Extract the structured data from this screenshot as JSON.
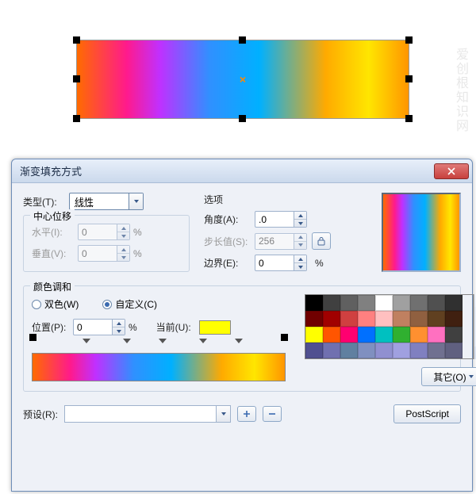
{
  "canvas": {
    "center_marker": "×"
  },
  "dialog": {
    "title": "渐变填充方式",
    "type_label": "类型(T):",
    "type_value": "线性",
    "center_shift_title": "中心位移",
    "horizontal_label": "水平(I):",
    "horizontal_value": "0",
    "vertical_label": "垂直(V):",
    "vertical_value": "0",
    "percent": "%",
    "options_title": "选项",
    "angle_label": "角度(A):",
    "angle_value": ".0",
    "step_label": "步长值(S):",
    "step_value": "256",
    "edge_label": "边界(E):",
    "edge_value": "0",
    "harmony_title": "颜色调和",
    "two_color_label": "双色(W)",
    "custom_label": "自定义(C)",
    "position_label": "位置(P):",
    "position_value": "0",
    "current_label": "当前(U):",
    "current_color": "#ffff00",
    "other_btn": "其它(O)",
    "preset_label": "预设(R):",
    "postscript_btn": "PostScript",
    "palette": [
      [
        "#000000",
        "#404040",
        "#606060",
        "#808080",
        "#ffffff",
        "#a0a0a0",
        "#707070",
        "#505050",
        "#303030"
      ],
      [
        "#700000",
        "#a00000",
        "#d04040",
        "#ff8080",
        "#ffc0c0",
        "#c08060",
        "#906040",
        "#604020",
        "#402010"
      ],
      [
        "#ffff00",
        "#ff5500",
        "#ff0070",
        "#0070ff",
        "#00c0c0",
        "#30b030",
        "#ff9030",
        "#ff70c0",
        "#404040"
      ],
      [
        "#505090",
        "#7070b0",
        "#6080a0",
        "#8090c0",
        "#9090d0",
        "#a0a0e0",
        "#8080c0",
        "#707090",
        "#606080"
      ]
    ],
    "grad_stops_pct": [
      0,
      22,
      38,
      52,
      68,
      82
    ]
  },
  "watermark": "爱创根知识网"
}
